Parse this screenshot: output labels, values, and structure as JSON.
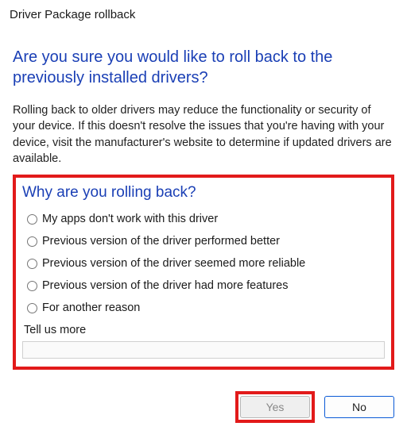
{
  "window": {
    "title": "Driver Package rollback"
  },
  "heading": "Are you sure you would like to roll back to the previously installed drivers?",
  "description": "Rolling back to older drivers may reduce the functionality or security of your device. If this doesn't resolve the issues that you're having with your device, visit the manufacturer's website to determine if updated drivers are available.",
  "form": {
    "question": "Why are you rolling back?",
    "options": [
      "My apps don't work with this driver",
      "Previous version of the driver performed better",
      "Previous version of the driver seemed more reliable",
      "Previous version of the driver had more features",
      "For another reason"
    ],
    "tell_more_label": "Tell us more",
    "tell_more_value": ""
  },
  "buttons": {
    "yes": "Yes",
    "no": "No"
  },
  "highlight_color": "#e21a1a",
  "accent_color": "#1a3fb5"
}
